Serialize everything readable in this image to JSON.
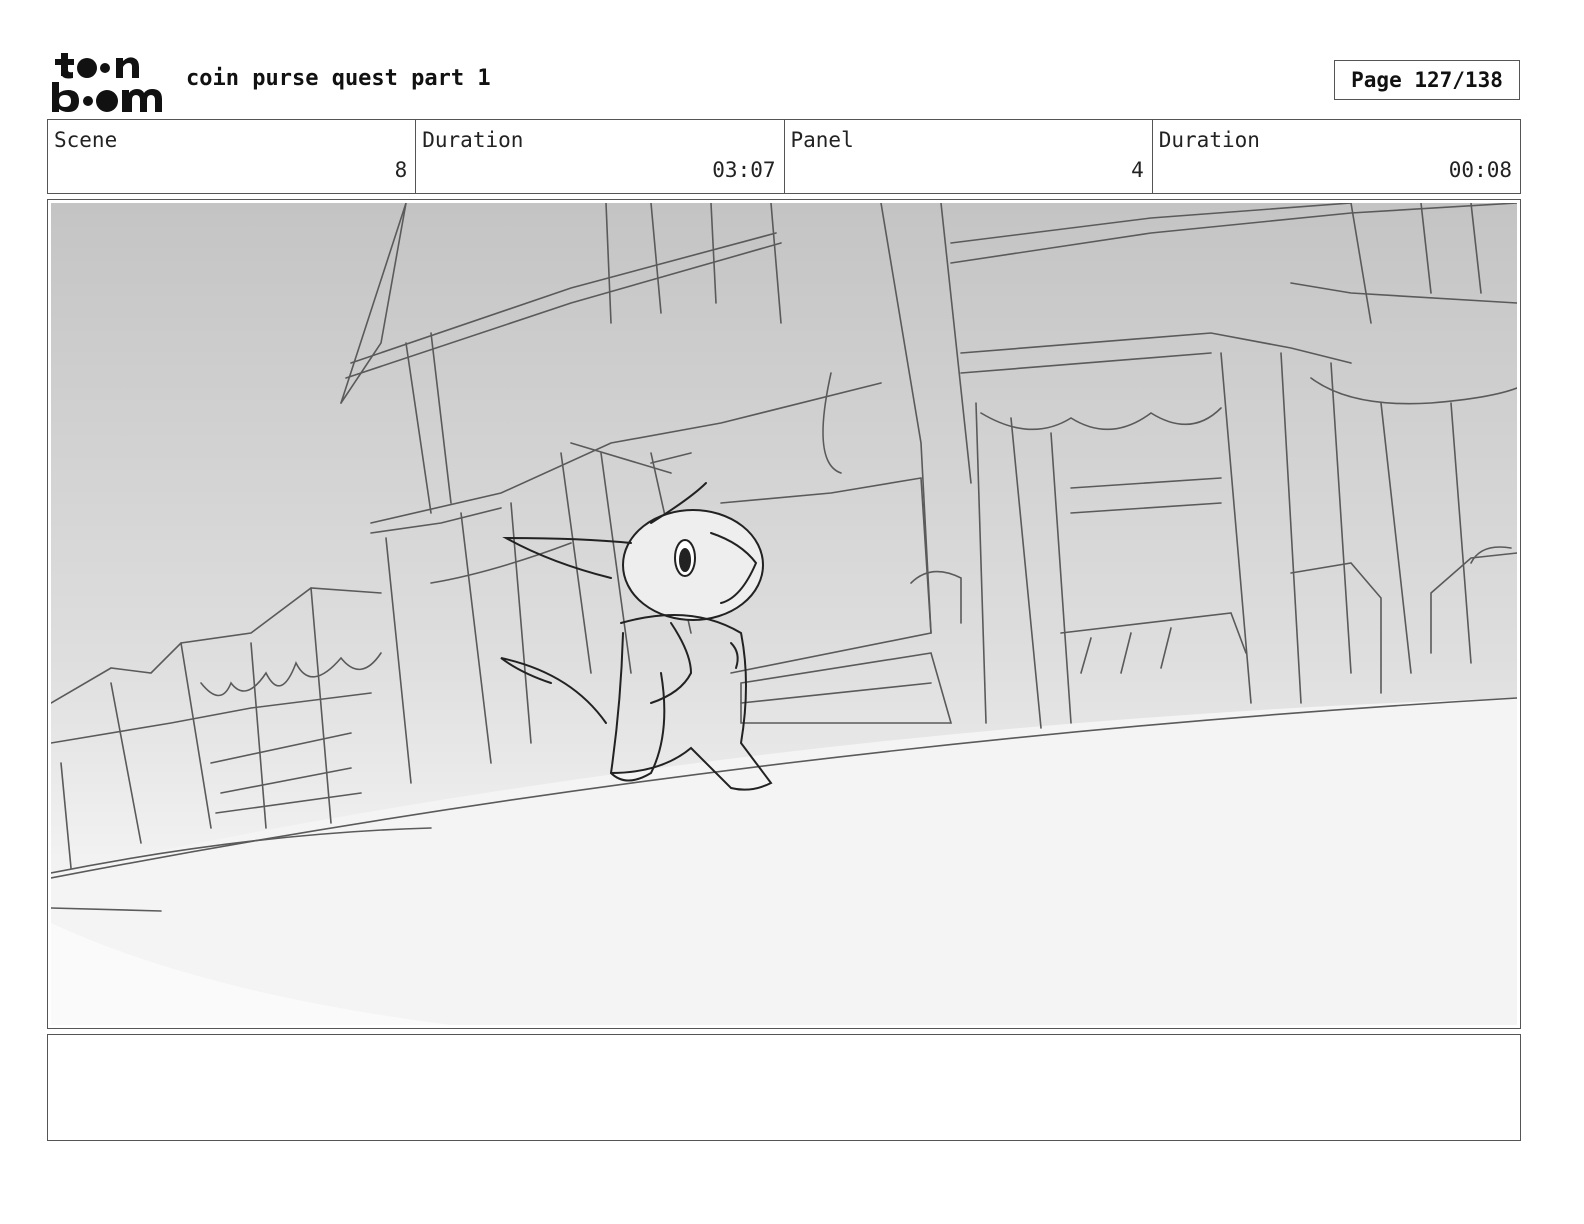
{
  "header": {
    "logo_text": "toon boom",
    "project_title": "coin purse quest part 1",
    "page_label": "Page 127/138"
  },
  "info": {
    "scene_label": "Scene",
    "scene_value": "8",
    "scene_duration_label": "Duration",
    "scene_duration_value": "03:07",
    "panel_label": "Panel",
    "panel_value": "4",
    "panel_duration_label": "Duration",
    "panel_duration_value": "00:08"
  },
  "notes": {
    "text": ""
  }
}
